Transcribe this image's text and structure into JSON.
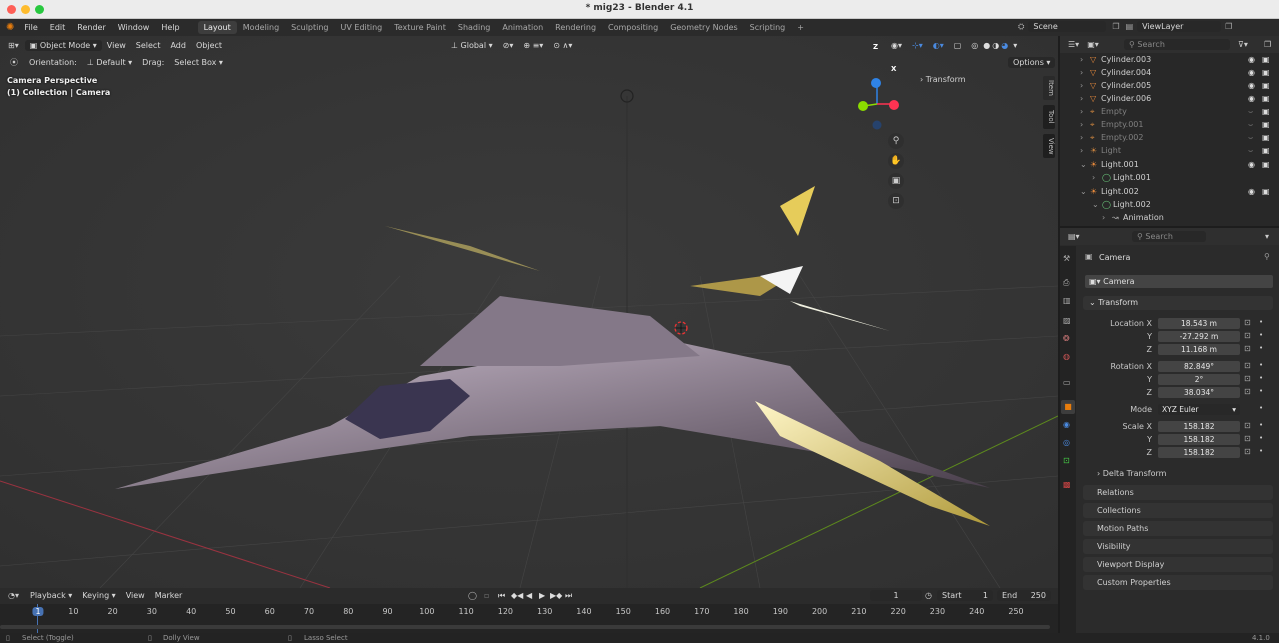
{
  "window": {
    "title": "* mig23 - Blender 4.1"
  },
  "menus": [
    "File",
    "Edit",
    "Render",
    "Window",
    "Help"
  ],
  "workspaces": [
    "Layout",
    "Modeling",
    "Sculpting",
    "UV Editing",
    "Texture Paint",
    "Shading",
    "Animation",
    "Rendering",
    "Compositing",
    "Geometry Nodes",
    "Scripting"
  ],
  "scene": {
    "name": "Scene",
    "view_layer": "ViewLayer"
  },
  "viewport": {
    "mode": "Object Mode",
    "menus": [
      "View",
      "Select",
      "Add",
      "Object"
    ],
    "transform_space": "Global",
    "orientation_label": "Orientation:",
    "orientation_value": "Default",
    "drag_label": "Drag:",
    "drag_value": "Select Box",
    "options": "Options",
    "overlay_line1": "Camera Perspective",
    "overlay_line2": "(1) Collection | Camera",
    "sidebar_panel": "Transform",
    "side_tabs": [
      "Item",
      "Tool",
      "View"
    ],
    "gizmo": {
      "z": "Z",
      "x": "X"
    }
  },
  "outliner": {
    "search_placeholder": "Search",
    "rows": [
      {
        "label": "Cylinder.003",
        "dim": false
      },
      {
        "label": "Cylinder.004",
        "dim": false
      },
      {
        "label": "Cylinder.005",
        "dim": false
      },
      {
        "label": "Cylinder.006",
        "dim": false
      },
      {
        "label": "Empty",
        "dim": true
      },
      {
        "label": "Empty.001",
        "dim": true
      },
      {
        "label": "Empty.002",
        "dim": true
      },
      {
        "label": "Light",
        "dim": true
      },
      {
        "label": "Light.001",
        "dim": false
      },
      {
        "label": "Light.001",
        "dim": false
      },
      {
        "label": "Light.002",
        "dim": false
      },
      {
        "label": "Light.002",
        "dim": false
      },
      {
        "label": "Animation",
        "dim": false
      }
    ]
  },
  "properties": {
    "search_placeholder": "Search",
    "object_name": "Camera",
    "object_field": "Camera",
    "transform_label": "Transform",
    "location": {
      "label": "Location X",
      "y_label": "Y",
      "z_label": "Z",
      "x": "18.543 m",
      "y": "-27.292 m",
      "z": "11.168 m"
    },
    "rotation": {
      "label": "Rotation X",
      "y_label": "Y",
      "z_label": "Z",
      "x": "82.849°",
      "y": "2°",
      "z": "38.034°"
    },
    "mode": {
      "label": "Mode",
      "value": "XYZ Euler"
    },
    "scale": {
      "label": "Scale X",
      "y_label": "Y",
      "z_label": "Z",
      "x": "158.182",
      "y": "158.182",
      "z": "158.182"
    },
    "delta_transform": "Delta Transform",
    "panels": [
      "Relations",
      "Collections",
      "Motion Paths",
      "Visibility",
      "Viewport Display",
      "Custom Properties"
    ]
  },
  "timeline": {
    "menus": [
      "Playback",
      "Keying",
      "View",
      "Marker"
    ],
    "current_frame": "1",
    "start_label": "Start",
    "start": "1",
    "end_label": "End",
    "end": "250",
    "ticks": [
      "1",
      "10",
      "20",
      "30",
      "40",
      "50",
      "60",
      "70",
      "80",
      "90",
      "100",
      "110",
      "120",
      "130",
      "140",
      "150",
      "160",
      "170",
      "180",
      "190",
      "200",
      "210",
      "220",
      "230",
      "240",
      "250"
    ]
  },
  "status": {
    "select": "Select (Toggle)",
    "dolly": "Dolly View",
    "lasso": "Lasso Select",
    "version": "4.1.0"
  },
  "colors": {
    "accent": "#4772b3",
    "axis_x": "#ff3352",
    "axis_y": "#8bdc00",
    "axis_z": "#2f83e6"
  }
}
